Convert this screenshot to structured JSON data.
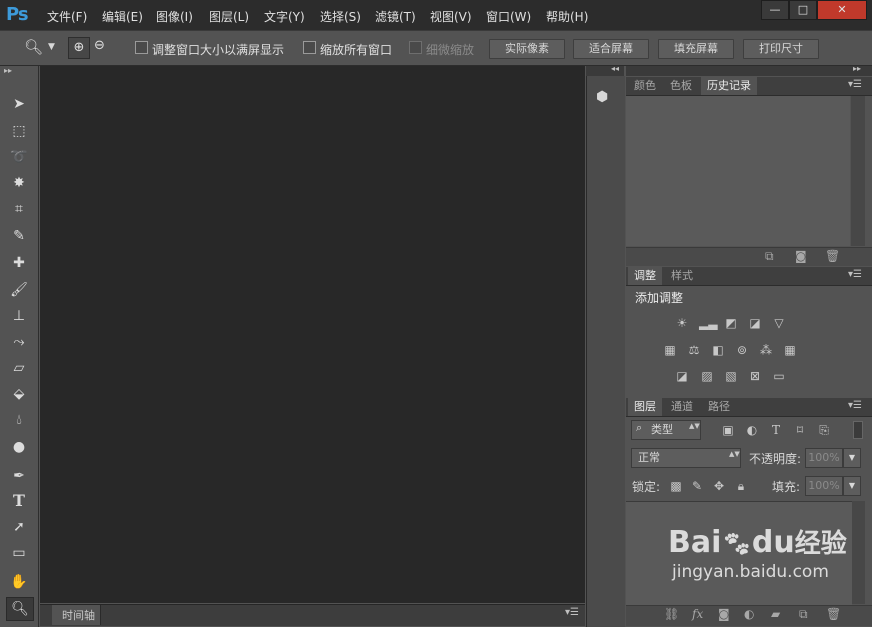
{
  "app": {
    "logo": "Ps"
  },
  "menu": [
    "文件(F)",
    "编辑(E)",
    "图像(I)",
    "图层(L)",
    "文字(Y)",
    "选择(S)",
    "滤镜(T)",
    "视图(V)",
    "窗口(W)",
    "帮助(H)"
  ],
  "window_controls": {
    "minimize": "—",
    "maximize": "□",
    "close": "✕"
  },
  "options": {
    "resize_windows_label": "调整窗口大小以满屏显示",
    "zoom_all_label": "缩放所有窗口",
    "scrubby_label": "细微缩放",
    "actual_pixels": "实际像素",
    "fit_screen": "适合屏幕",
    "fill_screen": "填充屏幕",
    "print_size": "打印尺寸"
  },
  "timeline": {
    "label": "时间轴"
  },
  "panels": {
    "top_tabs": [
      "颜色",
      "色板",
      "历史记录"
    ],
    "adjust_tabs": [
      "调整",
      "样式"
    ],
    "adjust_title": "添加调整",
    "layers_tabs": [
      "图层",
      "通道",
      "路径"
    ],
    "filter_kind": "类型",
    "blend_mode": "正常",
    "opacity_label": "不透明度:",
    "opacity_value": "100%",
    "lock_label": "锁定:",
    "fill_label": "填充:",
    "fill_value": "100%"
  },
  "watermark": {
    "brand": "Bai",
    "brand2": "du",
    "brand3": "经验",
    "url": "jingyan.baidu.com"
  }
}
